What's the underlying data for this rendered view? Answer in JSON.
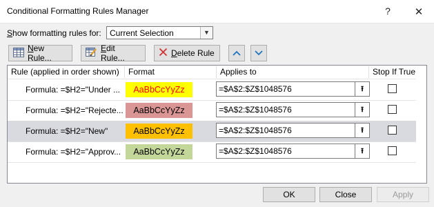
{
  "window": {
    "title": "Conditional Formatting Rules Manager",
    "help_glyph": "?",
    "close_glyph": "✕"
  },
  "show_rules": {
    "label_prefix": "",
    "label_underlined": "S",
    "label_rest": "how formatting rules for:",
    "selected": "Current Selection"
  },
  "toolbar": {
    "new_rule_u": "N",
    "new_rule_rest": "ew Rule...",
    "edit_rule_u": "E",
    "edit_rule_rest": "dit Rule...",
    "delete_rule_u": "D",
    "delete_rule_rest": "elete Rule"
  },
  "table": {
    "headers": {
      "rule": "Rule (applied in order shown)",
      "format": "Format",
      "applies_to": "Applies to",
      "stop_if_true": "Stop If True"
    },
    "rows": [
      {
        "rule": "Formula: =$H2=\"Under ...",
        "preview": "AaBbCcYyZz",
        "applies_to": "=$A$2:$Z$1048576",
        "stop_if_true": false,
        "bg": "#ffff00",
        "fg": "#ff0000"
      },
      {
        "rule": "Formula: =$H2=\"Rejecte...",
        "preview": "AaBbCcYyZz",
        "applies_to": "=$A$2:$Z$1048576",
        "stop_if_true": false,
        "bg": "#da9694",
        "fg": "#000000"
      },
      {
        "rule": "Formula: =$H2=\"New\"",
        "preview": "AaBbCcYyZz",
        "applies_to": "=$A$2:$Z$1048576",
        "stop_if_true": false,
        "bg": "#ffc000",
        "fg": "#000000"
      },
      {
        "rule": "Formula: =$H2=\"Approv...",
        "preview": "AaBbCcYyZz",
        "applies_to": "=$A$2:$Z$1048576",
        "stop_if_true": false,
        "bg": "#c4d79b",
        "fg": "#000000"
      }
    ],
    "selected_row_index": 2
  },
  "footer": {
    "ok": "OK",
    "close": "Close",
    "apply": "Apply"
  },
  "colors": {
    "accent_arrow": "#1e73be",
    "delete_x": "#d03030",
    "selected_row": "#d9d9e0"
  }
}
